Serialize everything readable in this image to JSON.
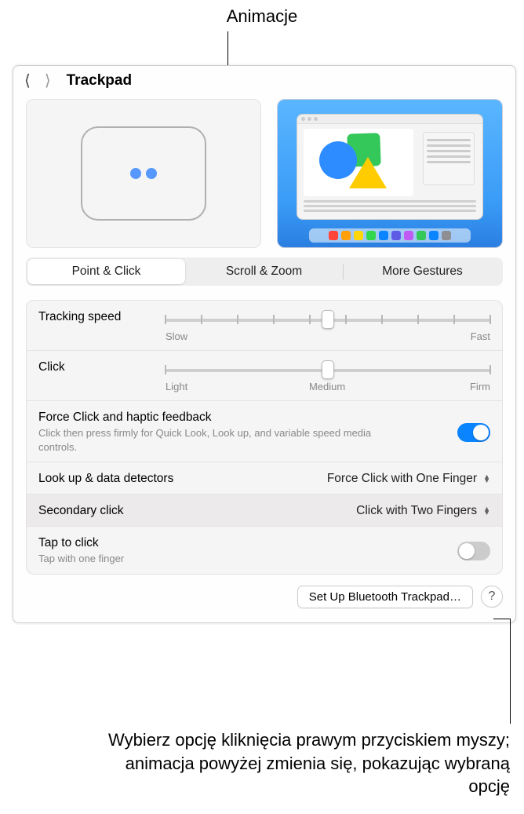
{
  "callouts": {
    "top": "Animacje",
    "bottom": "Wybierz opcję kliknięcia prawym przyciskiem myszy; animacja powyżej zmienia się, pokazując wybraną opcję"
  },
  "header": {
    "title": "Trackpad"
  },
  "tabs": {
    "point_click": "Point & Click",
    "scroll_zoom": "Scroll & Zoom",
    "more_gestures": "More Gestures"
  },
  "tracking_speed": {
    "label": "Tracking speed",
    "slow": "Slow",
    "fast": "Fast",
    "value_percent": 50,
    "ticks": 10
  },
  "click_strength": {
    "label": "Click",
    "light": "Light",
    "medium": "Medium",
    "firm": "Firm",
    "value_percent": 50,
    "ticks": 3
  },
  "force_click": {
    "label": "Force Click and haptic feedback",
    "desc": "Click then press firmly for Quick Look, Look up, and variable speed media controls.",
    "on": true
  },
  "lookup": {
    "label": "Look up & data detectors",
    "value": "Force Click with One Finger"
  },
  "secondary": {
    "label": "Secondary click",
    "value": "Click with Two Fingers"
  },
  "tap_to_click": {
    "label": "Tap to click",
    "desc": "Tap with one finger",
    "on": false
  },
  "buttons": {
    "bluetooth": "Set Up Bluetooth Trackpad…",
    "help": "?"
  },
  "dock_colors": [
    "#ff453a",
    "#ff9f0a",
    "#ffd60a",
    "#32d74b",
    "#0a84ff",
    "#5e5ce6",
    "#bf5af2",
    "#34c759",
    "#0a84ff",
    "#8e8e93"
  ]
}
